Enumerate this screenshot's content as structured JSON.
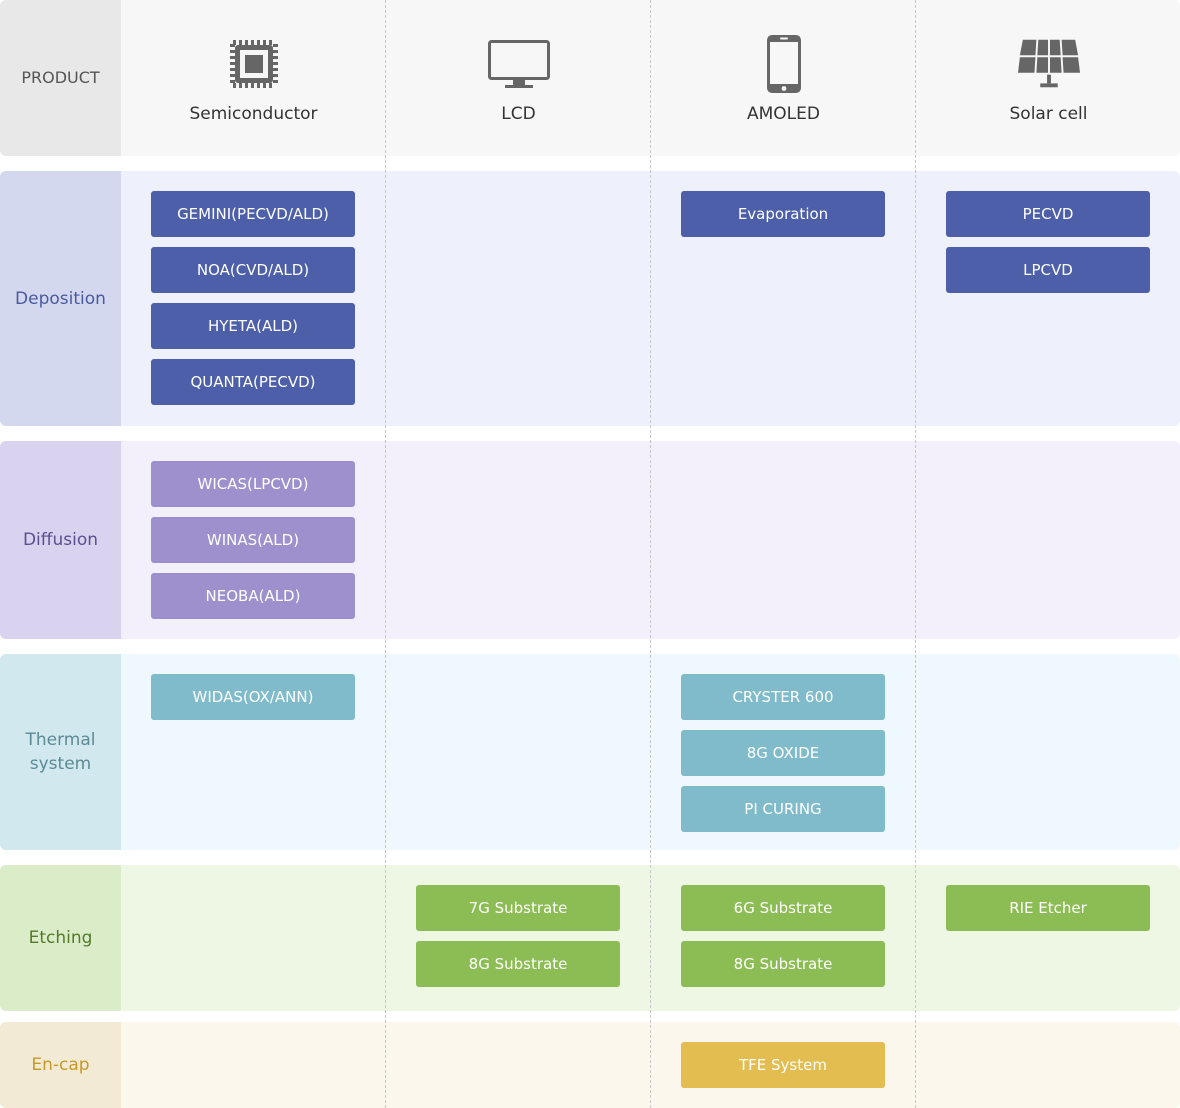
{
  "header": {
    "label": "PRODUCT",
    "products": [
      {
        "name": "Semiconductor",
        "icon": "chip-icon"
      },
      {
        "name": "LCD",
        "icon": "monitor-icon"
      },
      {
        "name": "AMOLED",
        "icon": "smartphone-icon"
      },
      {
        "name": "Solar cell",
        "icon": "solar-panel-icon"
      }
    ]
  },
  "colors": {
    "deposition": "#4c5fa8",
    "diffusion": "#9e8fcd",
    "thermal": "#7fbbca",
    "etching": "#8cbc54",
    "encap": "#e3bd50"
  },
  "rows": {
    "deposition": {
      "label": "Deposition",
      "semiconductor": [
        "GEMINI(PECVD/ALD)",
        "NOA(CVD/ALD)",
        "HYETA(ALD)",
        "QUANTA(PECVD)"
      ],
      "amoled": [
        "Evaporation"
      ],
      "solar": [
        "PECVD",
        "LPCVD"
      ]
    },
    "diffusion": {
      "label": "Diffusion",
      "semiconductor": [
        "WICAS(LPCVD)",
        "WINAS(ALD)",
        "NEOBA(ALD)"
      ]
    },
    "thermal": {
      "label_line1": "Thermal",
      "label_line2": "system",
      "semiconductor": [
        "WIDAS(OX/ANN)"
      ],
      "amoled": [
        "CRYSTER 600",
        "8G OXIDE",
        "PI CURING"
      ]
    },
    "etching": {
      "label": "Etching",
      "lcd": [
        "7G Substrate",
        "8G Substrate"
      ],
      "amoled": [
        "6G Substrate",
        "8G Substrate"
      ],
      "solar": [
        "RIE Etcher"
      ]
    },
    "encap": {
      "label": "En-cap",
      "amoled": [
        "TFE System"
      ]
    }
  }
}
